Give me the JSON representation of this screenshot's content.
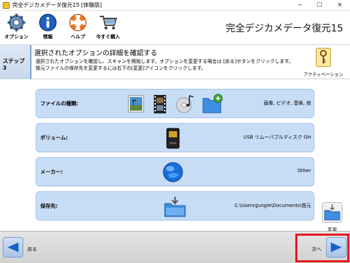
{
  "window": {
    "title": "完全デジカメデータ復元15 [体験版]",
    "min_glyph": "─",
    "max_glyph": "☐",
    "close_glyph": "✕"
  },
  "toolbar": {
    "options_label": "オプション",
    "info_label": "情報",
    "help_label": "ヘルプ",
    "buy_label": "今すぐ購入",
    "app_name": "完全デジカメデータ復元15"
  },
  "step": {
    "badge": "ステップ 3",
    "title": "選択されたオプションの詳細を確認する",
    "description": "選択されたオプションを確認し、スキャンを開始します。オプションを変更する場合は [戻る]ボタンをクリックします。復元ファイルの保存先を変更するには右下の[変更]アイコンをクリックします。",
    "activate_label": "アクティベーション"
  },
  "rows": {
    "file_type": {
      "label": "ファイルの種類:",
      "value": "画像, ビデオ, 音楽, 他"
    },
    "volume": {
      "label": "ボリューム:",
      "value": "USB リムーバブルディスク GH"
    },
    "maker": {
      "label": "メーカー:",
      "value": "Other"
    },
    "save_to": {
      "label": "保存先:",
      "value": "C:\\Users\\Jungle\\Documents\\復元"
    }
  },
  "change_label": "変更",
  "nav": {
    "back_label": "戻る",
    "next_label": "次へ"
  },
  "colors": {
    "row_bg": "#c7ddf6",
    "accent_blue": "#1b5fc9",
    "highlight": "#e8141c"
  }
}
